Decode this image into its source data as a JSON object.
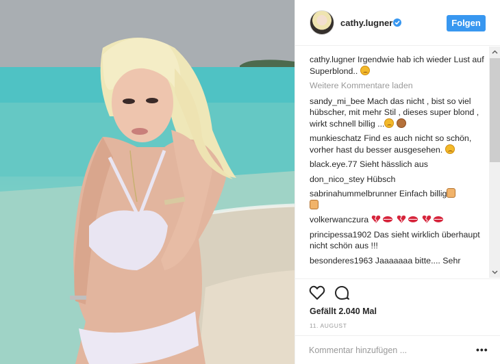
{
  "post": {
    "username": "cathy.lugner",
    "verified": true,
    "follow_label": "Folgen",
    "caption_user": "cathy.lugner",
    "caption_text": "Irgendwie hab ich wieder Lust auf Superblond..",
    "load_more": "Weitere Kommentare laden",
    "comments": [
      {
        "user": "sandy_mi_bee",
        "text": "Mach das nicht , bist so viel hübscher, mit mehr Stil , dieses super blond , wirkt schnell billig ..."
      },
      {
        "user": "munkieschatz",
        "text": "Find es auch nicht so schön, vorher hast du besser ausgesehen."
      },
      {
        "user": "black.eye.77",
        "text": "Sieht hässlich aus"
      },
      {
        "user": "don_nico_stey",
        "text": "Hübsch"
      },
      {
        "user": "sabrinahummelbrunner",
        "text": "Einfach billig"
      },
      {
        "user": "volkerwanczura",
        "text": ""
      },
      {
        "user": "principessa1902",
        "text": "Das sieht wirklich überhaupt nicht schön aus !!!"
      },
      {
        "user": "besonderes1963",
        "text": "Jaaaaaaa bitte.... Sehr"
      }
    ],
    "likes_text": "Gefällt 2.040 Mal",
    "date": "11. AUGUST",
    "add_comment_placeholder": "Kommentar hinzufügen ...",
    "more_label": "•••"
  },
  "colors": {
    "accent": "#3897f0",
    "muted": "#999999",
    "text": "#262626"
  }
}
